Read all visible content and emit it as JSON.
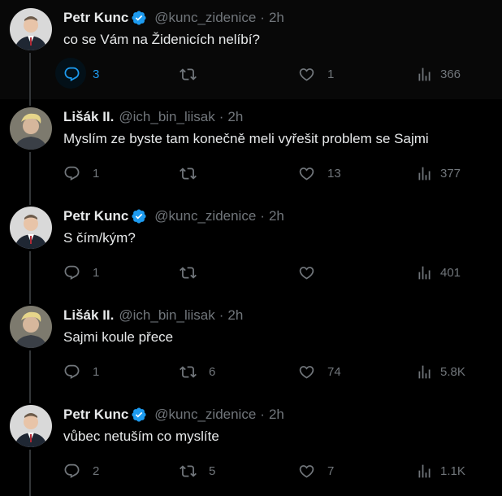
{
  "tweets": [
    {
      "author": "Petr Kunc",
      "handle": "@kunc_zidenice",
      "time": "2h",
      "verified": true,
      "text": "co se Vám na Židenicích nelíbí?",
      "stats": {
        "replies": "3",
        "retweets": "",
        "likes": "1",
        "views": "366"
      }
    },
    {
      "author": "Lišák II.",
      "handle": "@ich_bin_liisak",
      "time": "2h",
      "verified": false,
      "text": "Myslím ze byste tam konečně meli vyřešit problem se Sajmi",
      "stats": {
        "replies": "1",
        "retweets": "",
        "likes": "13",
        "views": "377"
      }
    },
    {
      "author": "Petr Kunc",
      "handle": "@kunc_zidenice",
      "time": "2h",
      "verified": true,
      "text": "S čím/kým?",
      "stats": {
        "replies": "1",
        "retweets": "",
        "likes": "",
        "views": "401"
      }
    },
    {
      "author": "Lišák II.",
      "handle": "@ich_bin_liisak",
      "time": "2h",
      "verified": false,
      "text": "Sajmi koule přece",
      "stats": {
        "replies": "1",
        "retweets": "6",
        "likes": "74",
        "views": "5.8K"
      }
    },
    {
      "author": "Petr Kunc",
      "handle": "@kunc_zidenice",
      "time": "2h",
      "verified": true,
      "text": "vůbec netuším co myslíte",
      "stats": {
        "replies": "2",
        "retweets": "5",
        "likes": "7",
        "views": "1.1K"
      }
    }
  ],
  "separator": "·",
  "colors": {
    "background": "#000000",
    "text": "#e7e9ea",
    "muted": "#71767b",
    "accent": "#1d9bf0",
    "thread_line": "#333639"
  },
  "icons": [
    "reply-icon",
    "retweet-icon",
    "like-icon",
    "views-icon",
    "verified-badge-icon"
  ]
}
